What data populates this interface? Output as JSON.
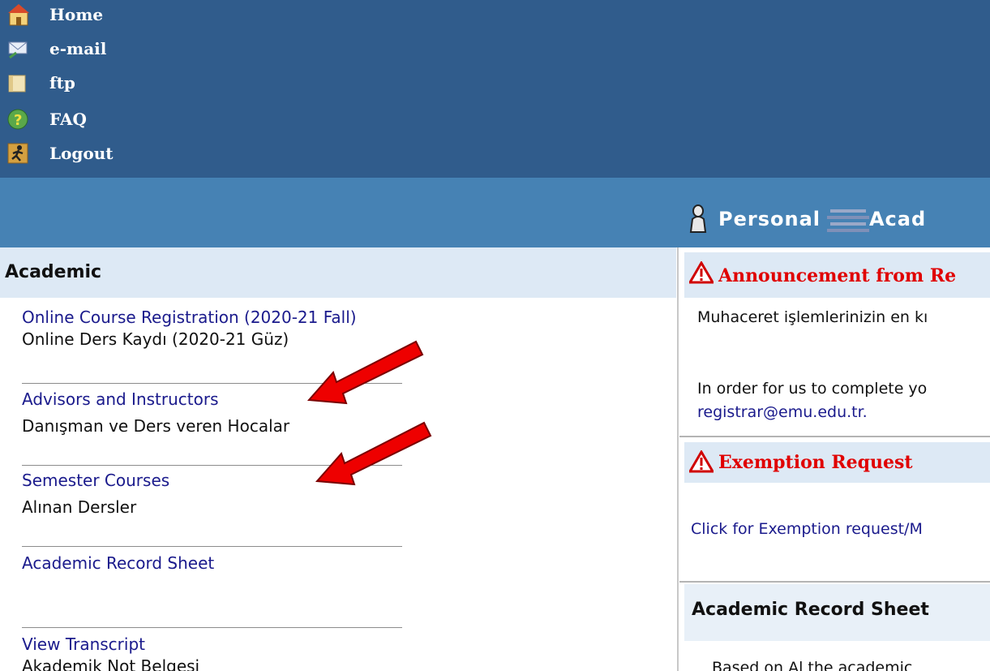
{
  "topnav": {
    "items": [
      {
        "label": "Home",
        "icon": "home-icon"
      },
      {
        "label": "e-mail",
        "icon": "email-icon"
      },
      {
        "label": "ftp",
        "icon": "folder-icon"
      },
      {
        "label": "FAQ",
        "icon": "help-icon"
      },
      {
        "label": "Logout",
        "icon": "logout-icon"
      }
    ]
  },
  "tabs": {
    "personal": "Personal",
    "academic_partial": "Acad"
  },
  "left": {
    "header": "Academic",
    "links": [
      {
        "en": "Online Course Registration (2020-21 Fall)",
        "tr": "Online Ders Kaydı (2020-21 Güz)"
      },
      {
        "en": "Advisors and Instructors",
        "tr": "Danışman ve Ders veren Hocalar"
      },
      {
        "en": "Semester Courses",
        "tr": "Alınan Dersler"
      },
      {
        "en": "Academic Record Sheet",
        "tr": ""
      },
      {
        "en": "View Transcript",
        "tr": "Akademik Not Belgesi"
      }
    ]
  },
  "right": {
    "announcement": {
      "title": "Announcement from Re",
      "line1": "Muhaceret işlemlerinizin en kı",
      "line2": "In order for us to complete yo",
      "email": "registrar@emu.edu.tr."
    },
    "exemption": {
      "title": "Exemption Request",
      "link": "Click for Exemption request/M"
    },
    "record": {
      "title": "Academic Record Sheet",
      "partial": "Based on Al the academic"
    }
  },
  "colors": {
    "topnav_bg": "#305c8c",
    "subbar_bg": "#4682b4",
    "header_bg": "#dde9f5",
    "link": "#1a1a8c",
    "alert_red": "#e00000",
    "annotation_arrow": "#ee0000"
  }
}
